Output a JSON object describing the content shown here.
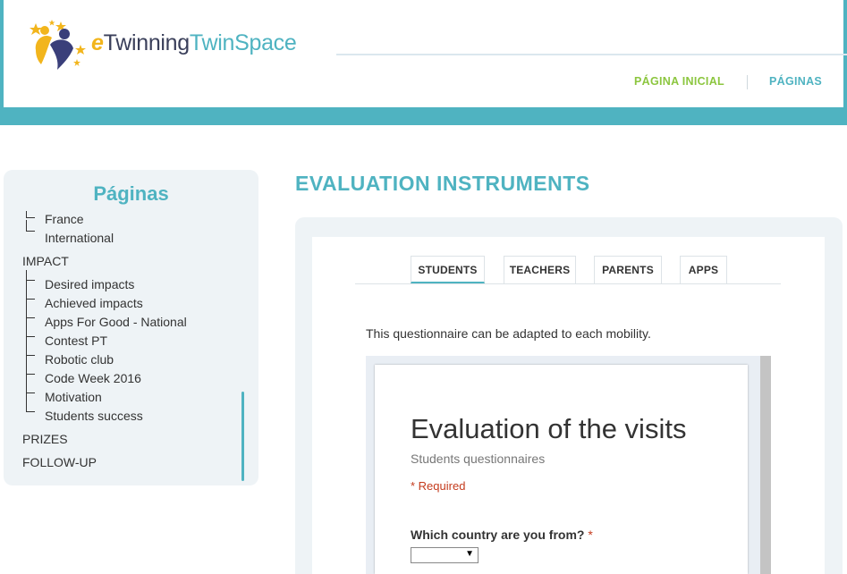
{
  "header": {
    "logo": {
      "e": "e",
      "twinning": "Twinning",
      "twinspace": "TwinSpace"
    },
    "nav": [
      {
        "label": "PÁGINA INICIAL"
      },
      {
        "label": "PÁGINAS"
      }
    ]
  },
  "sidebar": {
    "title": "Páginas",
    "items": [
      {
        "label": "France",
        "level": "child"
      },
      {
        "label": "International",
        "level": "child"
      },
      {
        "label": "IMPACT",
        "level": "top"
      },
      {
        "label": "Desired impacts",
        "level": "child"
      },
      {
        "label": "Achieved impacts",
        "level": "child"
      },
      {
        "label": "Apps For Good - National",
        "level": "child"
      },
      {
        "label": "Contest PT",
        "level": "child"
      },
      {
        "label": "Robotic club",
        "level": "child"
      },
      {
        "label": "Code Week 2016",
        "level": "child"
      },
      {
        "label": "Motivation",
        "level": "child"
      },
      {
        "label": "Students success",
        "level": "child"
      },
      {
        "label": "PRIZES",
        "level": "top"
      },
      {
        "label": "FOLLOW-UP",
        "level": "top"
      }
    ]
  },
  "main": {
    "title": "EVALUATION INSTRUMENTS",
    "tabs": [
      {
        "label": "STUDENTS",
        "active": true
      },
      {
        "label": "TEACHERS",
        "active": false
      },
      {
        "label": "PARENTS",
        "active": false
      },
      {
        "label": "APPS",
        "active": false
      }
    ],
    "intro": "This questionnaire can be adapted to each mobility.",
    "form": {
      "title": "Evaluation of the visits",
      "subtitle": "Students questionnaires",
      "required_note": "* Required",
      "question": "Which country are you from?",
      "question_star": "*",
      "select_arrow": "▼"
    }
  },
  "colors": {
    "accent": "#4fb3c1",
    "green": "#8cc63f",
    "required": "#c43b1d"
  }
}
